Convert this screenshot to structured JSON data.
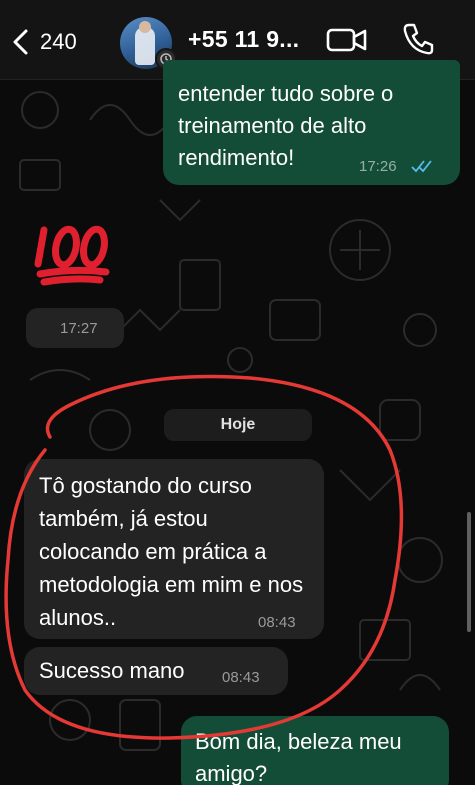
{
  "header": {
    "back_count": "240",
    "contact_name": "+55 11 9...",
    "icons": [
      "chevron-left-icon",
      "avatar",
      "status-icon",
      "video-camera-icon",
      "phone-icon"
    ]
  },
  "messages": [
    {
      "direction": "outgoing",
      "text": "entender tudo sobre o treinamento de alto rendimento!",
      "time": "17:26",
      "read": true
    },
    {
      "direction": "incoming",
      "type": "emoji",
      "emoji": "💯",
      "time": "17:27"
    },
    {
      "direction": "incoming",
      "text": "Tô gostando do curso também, já estou colocando em prática a metodologia em mim e nos alunos..",
      "time": "08:43"
    },
    {
      "direction": "incoming",
      "text": "Sucesso mano",
      "time": "08:43"
    },
    {
      "direction": "outgoing",
      "text": "Bom dia, beleza meu amigo?"
    }
  ],
  "date_divider": "Hoje",
  "colors": {
    "background": "#0b0b0b",
    "incoming_bubble": "#232323",
    "outgoing_bubble": "#134d37",
    "read_ticks": "#53bdeb",
    "annotation_red": "#e53935"
  }
}
